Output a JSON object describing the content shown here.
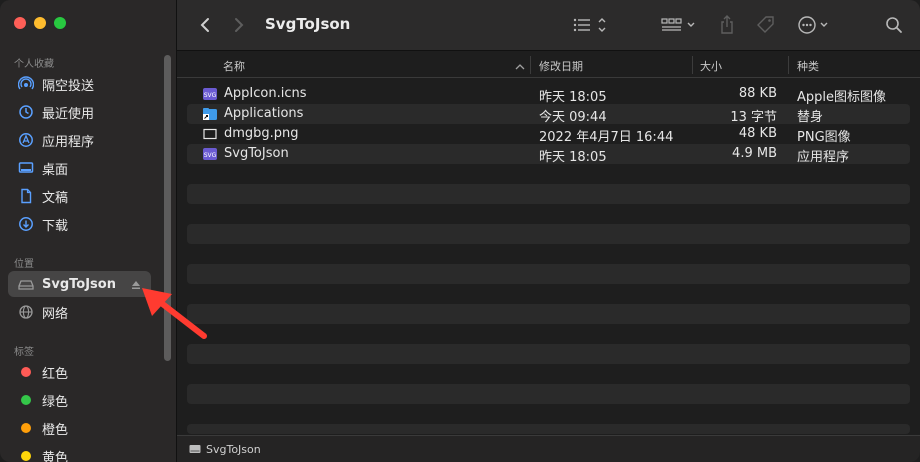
{
  "window_title": "SvgToJson",
  "sidebar": {
    "favorites_header": "个人收藏",
    "favorites": [
      {
        "label": "隔空投送",
        "icon": "airdrop-icon"
      },
      {
        "label": "最近使用",
        "icon": "clock-icon"
      },
      {
        "label": "应用程序",
        "icon": "applications-icon"
      },
      {
        "label": "桌面",
        "icon": "desktop-icon"
      },
      {
        "label": "文稿",
        "icon": "document-icon"
      },
      {
        "label": "下载",
        "icon": "download-icon"
      }
    ],
    "locations_header": "位置",
    "locations": [
      {
        "label": "SvgToJson",
        "icon": "disk-icon",
        "selected": true
      },
      {
        "label": "网络",
        "icon": "network-icon"
      }
    ],
    "tags_header": "标签",
    "tags": [
      {
        "label": "红色",
        "color": "#ff5b56"
      },
      {
        "label": "绿色",
        "color": "#34c749"
      },
      {
        "label": "橙色",
        "color": "#ff9f0a"
      },
      {
        "label": "黄色",
        "color": "#ffd60a"
      }
    ]
  },
  "columns": {
    "name": "名称",
    "modified": "修改日期",
    "size": "大小",
    "kind": "种类"
  },
  "files": [
    {
      "name": "AppIcon.icns",
      "modified": "昨天 18:05",
      "size": "88 KB",
      "kind": "Apple图标图像",
      "icon": "svg-file-icon"
    },
    {
      "name": "Applications",
      "modified": "今天 09:44",
      "size": "13 字节",
      "kind": "替身",
      "icon": "alias-folder-icon"
    },
    {
      "name": "dmgbg.png",
      "modified": "2022 年4月7日 16:44",
      "size": "48 KB",
      "kind": "PNG图像",
      "icon": "png-file-icon"
    },
    {
      "name": "SvgToJson",
      "modified": "昨天 18:05",
      "size": "4.9 MB",
      "kind": "应用程序",
      "icon": "svg-app-icon"
    }
  ],
  "pathbar": {
    "label": "SvgToJson"
  },
  "colors": {
    "accent_red_arrow": "#ff3b30",
    "selection": "#464545"
  }
}
